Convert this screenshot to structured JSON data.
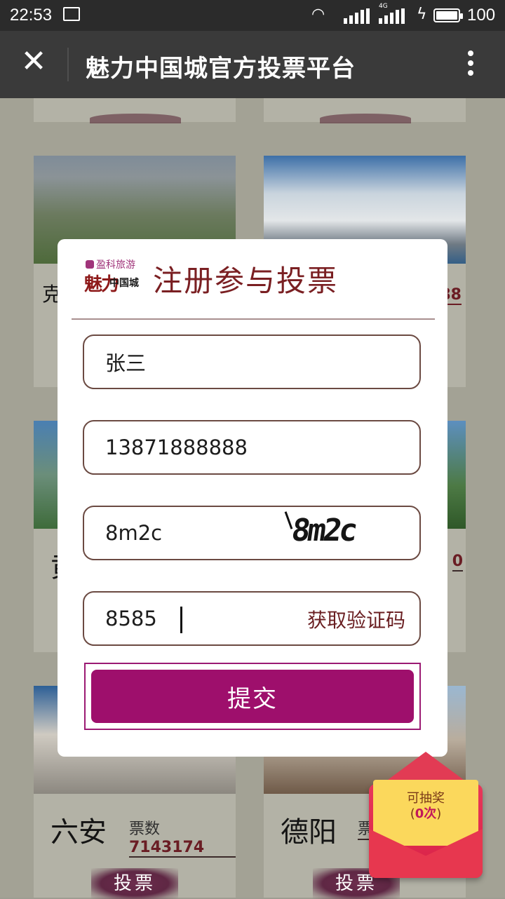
{
  "status_bar": {
    "time": "22:53",
    "network": "4G",
    "battery": "100"
  },
  "title_bar": {
    "close_icon": "close-icon",
    "title": "魅力中国城官方投票平台",
    "more_icon": "more-vertical-icon"
  },
  "background_cards": [
    {
      "city": "克",
      "votes_label": "",
      "votes": "88"
    },
    {
      "city": "黄",
      "votes_label": "",
      "votes": "0"
    },
    {
      "city": "六安",
      "votes_label": "票数",
      "votes": "7143174",
      "vote_button": "投票"
    },
    {
      "city": "德阳",
      "votes_label": "票",
      "votes": "",
      "vote_button": "投票"
    }
  ],
  "modal": {
    "brand_top": "盈科旅游",
    "brand_main": "魅力",
    "brand_sub": "中国城",
    "heading": "注册参与投票",
    "name_value": "张三",
    "phone_value": "13871888888",
    "captcha_input_value": "8m2c",
    "captcha_image_text": "8m2c",
    "sms_code_value": "8585",
    "sms_button_label": "获取验证码",
    "submit_label": "提交"
  },
  "lottery": {
    "line1": "可抽奖",
    "line2_prefix": "(",
    "count": "0次",
    "line2_suffix": ")"
  },
  "colors": {
    "accent": "#9e0f6c",
    "heading": "#7a1f22",
    "field_border": "#6b4a42"
  }
}
